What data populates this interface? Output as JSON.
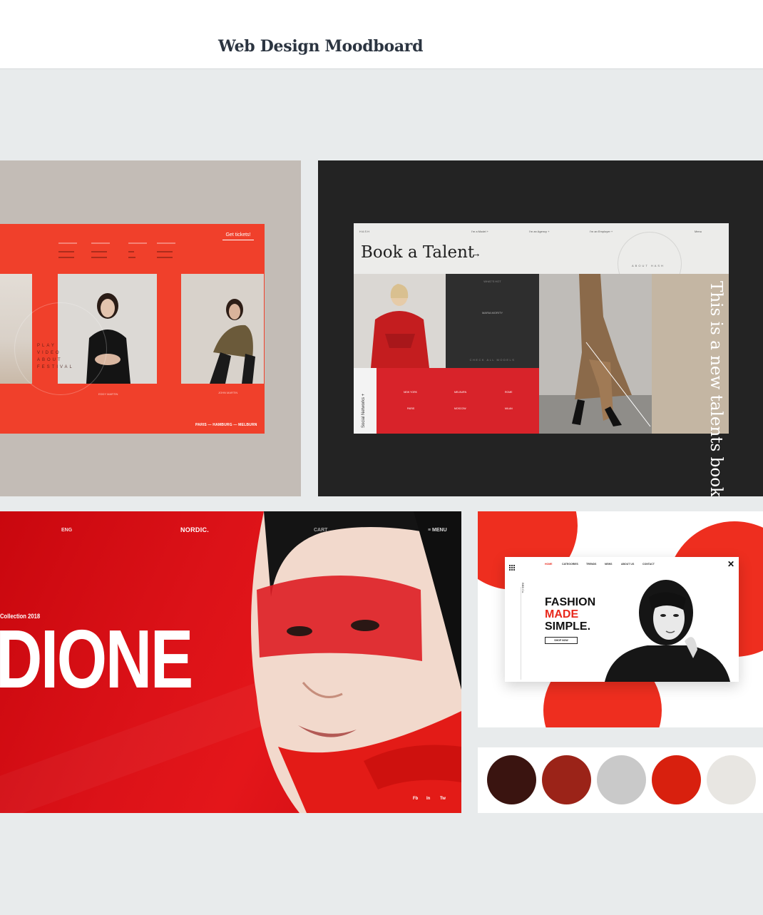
{
  "page": {
    "title": "Web Design Moodboard"
  },
  "festival": {
    "cta_label": "Get tickets!",
    "play_text": "PLAY VIDEO ABOUT FESTIVAL",
    "person_1": "EDDY MARTIN",
    "person_2": "JOHN MARTIN",
    "cities": "PARIS — HAMBURG — MELBURN"
  },
  "hash": {
    "brand": "H A S H",
    "nav_model": "I'm a Model +",
    "nav_agency": "I'm an Agency +",
    "nav_employer": "I'm an Employer +",
    "nav_menu": "Menu",
    "title": "Book a Talent",
    "arrow": "→",
    "about": "ABOUT HASH",
    "whats_hot": "WHAT'S HOT",
    "model_name": "MARIA MORITY",
    "check_all": "CHECK ALL MODELS",
    "tagline": "This is a new talents booking HASH platform.",
    "social_label": "Social Networks +",
    "cities": [
      "NEW YORK",
      "MELBURN",
      "ROME",
      "PARIS",
      "MOSCOW",
      "MILAN"
    ]
  },
  "nordic": {
    "lang": "ENG",
    "logo": "NORDIC.",
    "cart": "CART",
    "menu": "MENU",
    "collection": "Collection 2018",
    "headline": "DIONE",
    "social": [
      "Fb",
      "In",
      "Tw"
    ]
  },
  "fashion": {
    "nav": [
      "HOME",
      "CATEGORIES",
      "TRENDS",
      "NEWS",
      "ABOUT US",
      "CONTACT"
    ],
    "brand_side": "BBB Co.",
    "headline_line1": "FASHION",
    "headline_line2": "MADE",
    "headline_line3": "SIMPLE.",
    "shop_label": "SHOP NOW",
    "close_glyph": "✕",
    "accent": "#e8291c"
  },
  "palette": {
    "colors": [
      "#3a1410",
      "#9b2318",
      "#c9c9c9",
      "#d8200e",
      "#e8e6e2"
    ]
  }
}
